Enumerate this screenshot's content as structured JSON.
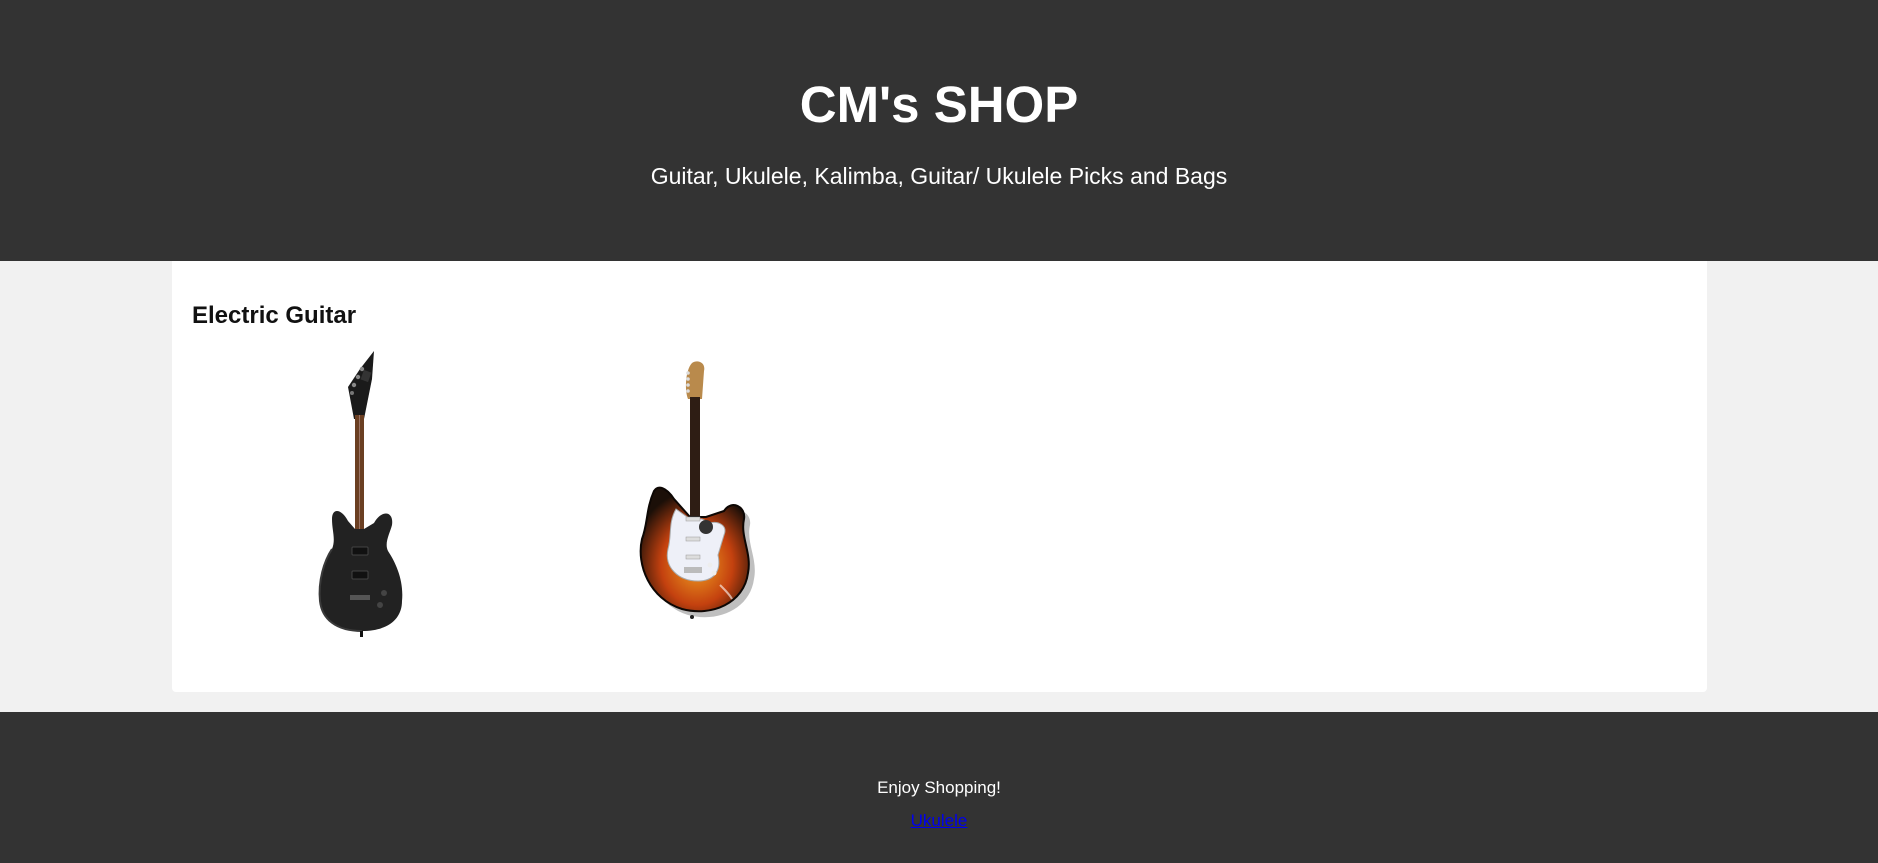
{
  "header": {
    "title": "CM's SHOP",
    "subtitle": "Guitar, Ukulele, Kalimba, Guitar/ Ukulele Picks and Bags"
  },
  "main": {
    "section_title": "Electric Guitar",
    "products": [
      {
        "icon": "black-electric-guitar-icon"
      },
      {
        "icon": "sunburst-electric-guitar-icon"
      }
    ]
  },
  "footer": {
    "tagline": "Enjoy Shopping!",
    "link_label": "Ukulele"
  },
  "colors": {
    "header_bg": "#333333",
    "page_bg": "#f1f1f1",
    "card_bg": "#ffffff",
    "link": "#0000ee"
  }
}
